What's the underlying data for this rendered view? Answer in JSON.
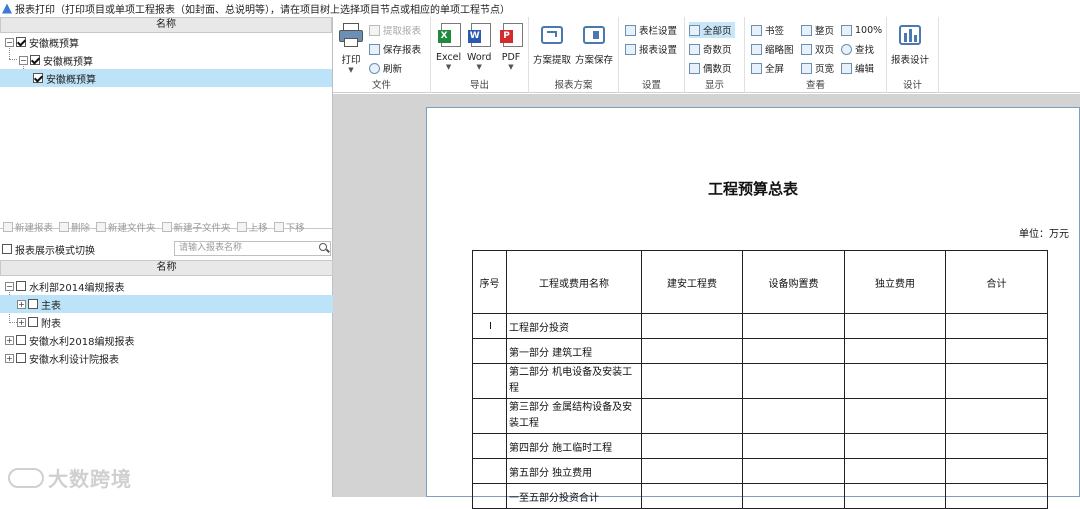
{
  "window": {
    "title": "报表打印（打印项目或单项工程报表（如封面、总说明等），请在项目树上选择项目节点或相应的单项工程节点）"
  },
  "project_tree": {
    "header": "名称",
    "items": [
      {
        "label": "安徽概预算",
        "checked": true
      },
      {
        "label": "安徽概预算",
        "checked": true
      },
      {
        "label": "安徽概预算",
        "checked": true
      }
    ]
  },
  "report_toolbar": {
    "new_report": "新建报表",
    "delete": "删除",
    "new_folder": "新建文件夹",
    "new_subfolder": "新建子文件夹",
    "move_up": "上移",
    "move_down": "下移"
  },
  "mode_toggle": {
    "label": "报表展示模式切换",
    "checked": false
  },
  "search": {
    "placeholder": "请输入报表名称"
  },
  "report_tree": {
    "header": "名称",
    "items": [
      {
        "label": "水利部2014编规报表",
        "expander": "−"
      },
      {
        "label": "主表",
        "expander": "+"
      },
      {
        "label": "附表",
        "expander": "+"
      },
      {
        "label": "安徽水利2018编规报表",
        "expander": "+"
      },
      {
        "label": "安徽水利设计院报表",
        "expander": "+"
      }
    ]
  },
  "ribbon": {
    "file": {
      "label": "文件",
      "print": "打印",
      "extract": "提取报表",
      "save": "保存报表",
      "refresh": "刷新"
    },
    "export": {
      "label": "导出",
      "excel": "Excel",
      "word": "Word",
      "pdf": "PDF"
    },
    "scheme": {
      "label": "报表方案",
      "extract": "方案提取",
      "save": "方案保存"
    },
    "settings": {
      "label": "设置",
      "column": "表栏设置",
      "report": "报表设置"
    },
    "display": {
      "label": "显示",
      "all": "全部页",
      "odd": "奇数页",
      "even": "偶数页"
    },
    "view": {
      "label": "查看",
      "bookmark": "书签",
      "thumbnail": "缩略图",
      "fullscreen": "全屏",
      "whole_page": "整页",
      "two_page": "双页",
      "page_width": "页宽",
      "zoom": "100%",
      "find": "查找",
      "edit": "编辑"
    },
    "design": {
      "label": "设计",
      "report_design": "报表设计"
    }
  },
  "report_page": {
    "title": "工程预算总表",
    "unit": "单位：万元",
    "columns": [
      "序号",
      "工程或费用名称",
      "建安工程费",
      "设备购置费",
      "独立费用",
      "合计"
    ],
    "rows": [
      {
        "no": "Ⅰ",
        "name": "工程部分投资"
      },
      {
        "no": "",
        "name": "第一部分  建筑工程"
      },
      {
        "no": "",
        "name": "第二部分  机电设备及安装工程"
      },
      {
        "no": "",
        "name": "第三部分  金属结构设备及安装工程"
      },
      {
        "no": "",
        "name": "第四部分  施工临时工程"
      },
      {
        "no": "",
        "name": "第五部分  独立费用"
      },
      {
        "no": "",
        "name": "一至五部分投资合计"
      }
    ]
  },
  "watermark": {
    "text": "大数跨境"
  },
  "colors": {
    "selection": "#bde3f8",
    "excel": "#1e8a3c",
    "word": "#2b5ab3",
    "pdf": "#d32b2b"
  }
}
